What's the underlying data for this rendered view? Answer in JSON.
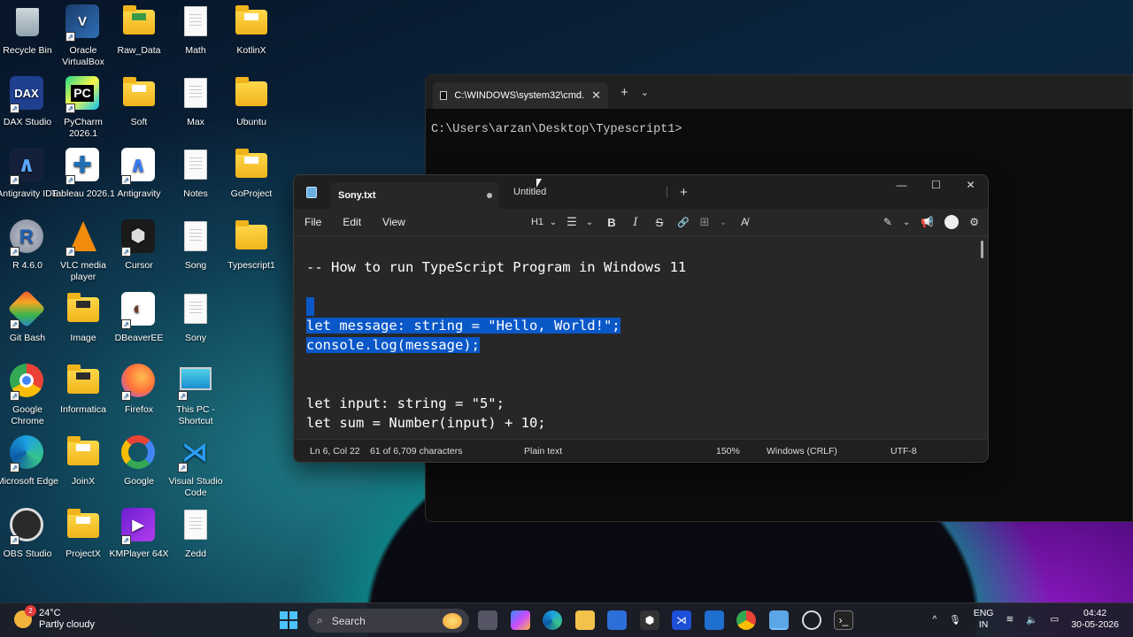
{
  "desktop": {
    "icons": [
      {
        "label": "Recycle Bin"
      },
      {
        "label": "Oracle VirtualBox"
      },
      {
        "label": "Raw_Data"
      },
      {
        "label": "Math"
      },
      {
        "label": "KotlinX"
      },
      {
        "label": "DAX Studio"
      },
      {
        "label": "PyCharm 2026.1"
      },
      {
        "label": "Soft"
      },
      {
        "label": "Max"
      },
      {
        "label": "Ubuntu"
      },
      {
        "label": "Antigravity IDE"
      },
      {
        "label": "Tableau 2026.1"
      },
      {
        "label": "Antigravity"
      },
      {
        "label": "Notes"
      },
      {
        "label": "GoProject"
      },
      {
        "label": "R 4.6.0"
      },
      {
        "label": "VLC media player"
      },
      {
        "label": "Cursor"
      },
      {
        "label": "Song"
      },
      {
        "label": "Typescript1"
      },
      {
        "label": "Git Bash"
      },
      {
        "label": "Image"
      },
      {
        "label": "DBeaverEE"
      },
      {
        "label": "Sony"
      },
      {
        "label": "Google Chrome"
      },
      {
        "label": "Informatica"
      },
      {
        "label": "Firefox"
      },
      {
        "label": "This PC - Shortcut"
      },
      {
        "label": "Microsoft Edge"
      },
      {
        "label": "JoinX"
      },
      {
        "label": "Google"
      },
      {
        "label": "Visual Studio Code"
      },
      {
        "label": "OBS Studio"
      },
      {
        "label": "ProjectX"
      },
      {
        "label": "KMPlayer 64X"
      },
      {
        "label": "Zedd"
      }
    ],
    "tile_texts": {
      "dax": "DAX",
      "pycharm": "PC",
      "r": "R"
    }
  },
  "cmd": {
    "tab_title": "C:\\WINDOWS\\system32\\cmd.",
    "close": "✕",
    "new_tab": "+",
    "dropdown": "⌄",
    "prompt": "C:\\Users\\arzan\\Desktop\\Typescript1>"
  },
  "notepad": {
    "active_tab": "Sony.txt",
    "second_tab": "Untitled",
    "new_tab": "+",
    "controls": {
      "minimize": "—",
      "maximize": "☐",
      "close": "✕"
    },
    "menu": {
      "file": "File",
      "edit": "Edit",
      "view": "View"
    },
    "toolbar": {
      "heading": "H1",
      "heading_chev": "⌄",
      "list": "☰",
      "list_chev": "⌄",
      "bold": "B",
      "italic": "I",
      "strike": "S",
      "link": "🔗",
      "table": "⊞",
      "table_chev": "⌄",
      "clear": "A̸"
    },
    "lines": {
      "l1": "-- How to run TypeScript Program in Windows 11",
      "l2": "let message: string = \"Hello, World!\";",
      "l3": "console.log(message);",
      "l4": "let input: string = \"5\";",
      "l5": "let sum = Number(input) + 10;"
    },
    "status": {
      "position": "Ln 6, Col 22",
      "selection": "61 of 6,709 characters",
      "format": "Plain text",
      "zoom": "150%",
      "eol": "Windows (CRLF)",
      "encoding": "UTF-8"
    }
  },
  "taskbar": {
    "weather_temp": "24°C",
    "weather_desc": "Partly cloudy",
    "weather_badge": "2",
    "search_placeholder": "Search",
    "lang_1": "ENG",
    "lang_2": "IN",
    "time": "04:42",
    "date": "30-05-2026",
    "chevron": "^"
  }
}
